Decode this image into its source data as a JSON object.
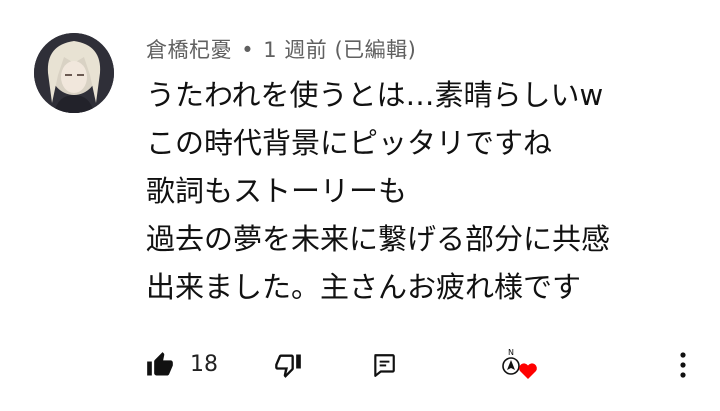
{
  "comment": {
    "author": "倉橋杞憂",
    "separator": "•",
    "time": "1 週前 (已編輯)",
    "lines": [
      "うたわれを使うとは…素晴らしいw",
      "この時代背景にピッタリですね",
      "歌詞もストーリーも",
      "過去の夢を未来に繋げる部分に共感",
      "出来ました。主さんお疲れ様です"
    ]
  },
  "actions": {
    "like_count": "18",
    "like_icon": "thumbs-up-icon",
    "dislike_icon": "thumbs-down-icon",
    "reply_icon": "reply-icon",
    "hearted_icon": "creator-heart-icon",
    "more_icon": "more-vert-icon"
  },
  "colors": {
    "heart": "#ff0000",
    "meta_text": "#606060",
    "text": "#111111"
  }
}
